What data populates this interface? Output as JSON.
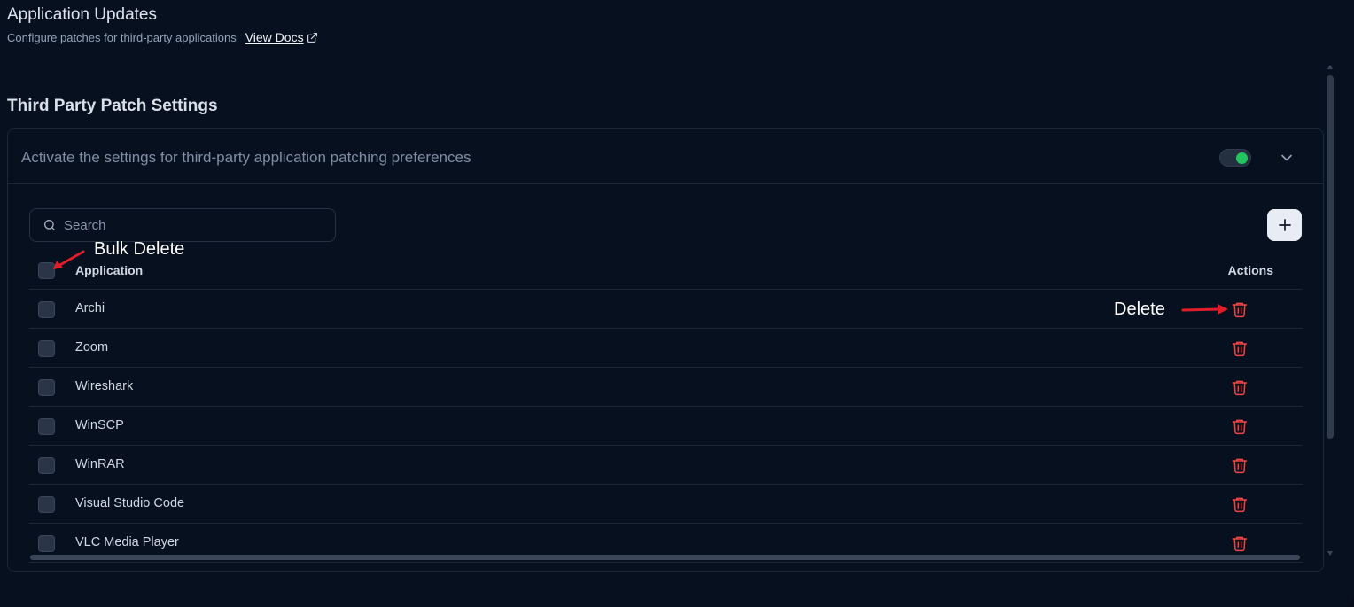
{
  "header": {
    "title": "Application Updates",
    "subtitle": "Configure patches for third-party applications",
    "docs_link": "View Docs"
  },
  "section": {
    "title": "Third Party Patch Settings",
    "description": "Activate the settings for third-party application patching preferences",
    "toggle_on": true
  },
  "search": {
    "placeholder": "Search"
  },
  "table": {
    "col_application": "Application",
    "col_actions": "Actions",
    "rows": [
      "Archi",
      "Zoom",
      "Wireshark",
      "WinSCP",
      "WinRAR",
      "Visual Studio Code",
      "VLC Media Player"
    ]
  },
  "annotations": {
    "bulk_delete": "Bulk Delete",
    "delete": "Delete"
  },
  "icons": {
    "search": "search-icon",
    "external": "external-link-icon",
    "chevron": "chevron-down-icon",
    "add": "plus-icon",
    "trash": "trash-icon"
  },
  "colors": {
    "accent_green": "#22c55e",
    "danger_red": "#ef4444",
    "annotation_red": "#e11d2a"
  }
}
